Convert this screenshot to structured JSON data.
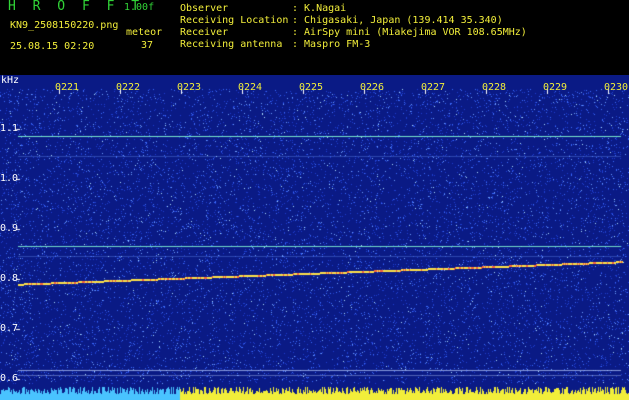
{
  "header": {
    "title": "H R O F F T",
    "version": "1.00f",
    "filename": "KN9_2508150220.png",
    "meteor_label": "meteor",
    "datetime": "25.08.15 02:20",
    "meteor_count": "37",
    "info": [
      {
        "key": "Observer",
        "value": ": K.Nagai"
      },
      {
        "key": "Receiving Location",
        "value": ": Chigasaki, Japan (139.414 35.340)"
      },
      {
        "key": "Receiver",
        "value": ": AirSpy mini (Miakejima VOR 108.65MHz)"
      },
      {
        "key": "Receiving antenna",
        "value": ": Maspro FM-3"
      }
    ]
  },
  "plot": {
    "y_unit": "kHz",
    "time_ticks": [
      "0221",
      "0222",
      "0223",
      "0224",
      "0225",
      "0226",
      "0227",
      "0228",
      "0229",
      "0230"
    ],
    "freq_ticks": [
      {
        "label": "1.1",
        "khz": 1.1
      },
      {
        "label": "1.0",
        "khz": 1.0
      },
      {
        "label": "0.9",
        "khz": 0.9
      },
      {
        "label": "0.8",
        "khz": 0.8
      },
      {
        "label": "0.7",
        "khz": 0.7
      },
      {
        "label": "0.6",
        "khz": 0.6
      }
    ],
    "colors": {
      "background": "#0a1a85",
      "noise": "#3c6bff",
      "carrier": "#7cf0d0",
      "signal": "#ffe24a",
      "power_bar": "#f2ee3a",
      "power_bar_left": "#49c3ff"
    }
  }
}
